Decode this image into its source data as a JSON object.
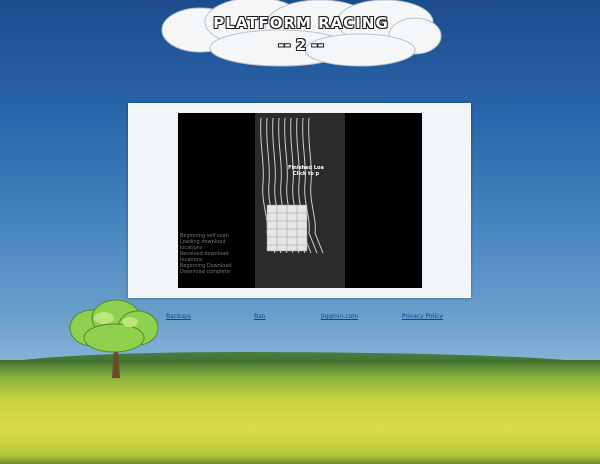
{
  "header": {
    "title": "PLATFORM RACING",
    "subtitle": "-- 2 --"
  },
  "game": {
    "status_line1": "Finished Loa",
    "status_line2": "Click to p",
    "log": [
      "Beginning self scan",
      "Loading download",
      "locations",
      "Received download",
      "locations",
      "Beginning Download",
      "Download complete"
    ]
  },
  "footer": {
    "links": [
      "Backups",
      "Ban",
      "Jiggmin.com",
      "Privacy Policy"
    ]
  },
  "colors": {
    "sky_top": "#1c4c8e",
    "grass": "#d7dc4a",
    "link": "#1a3d99"
  }
}
